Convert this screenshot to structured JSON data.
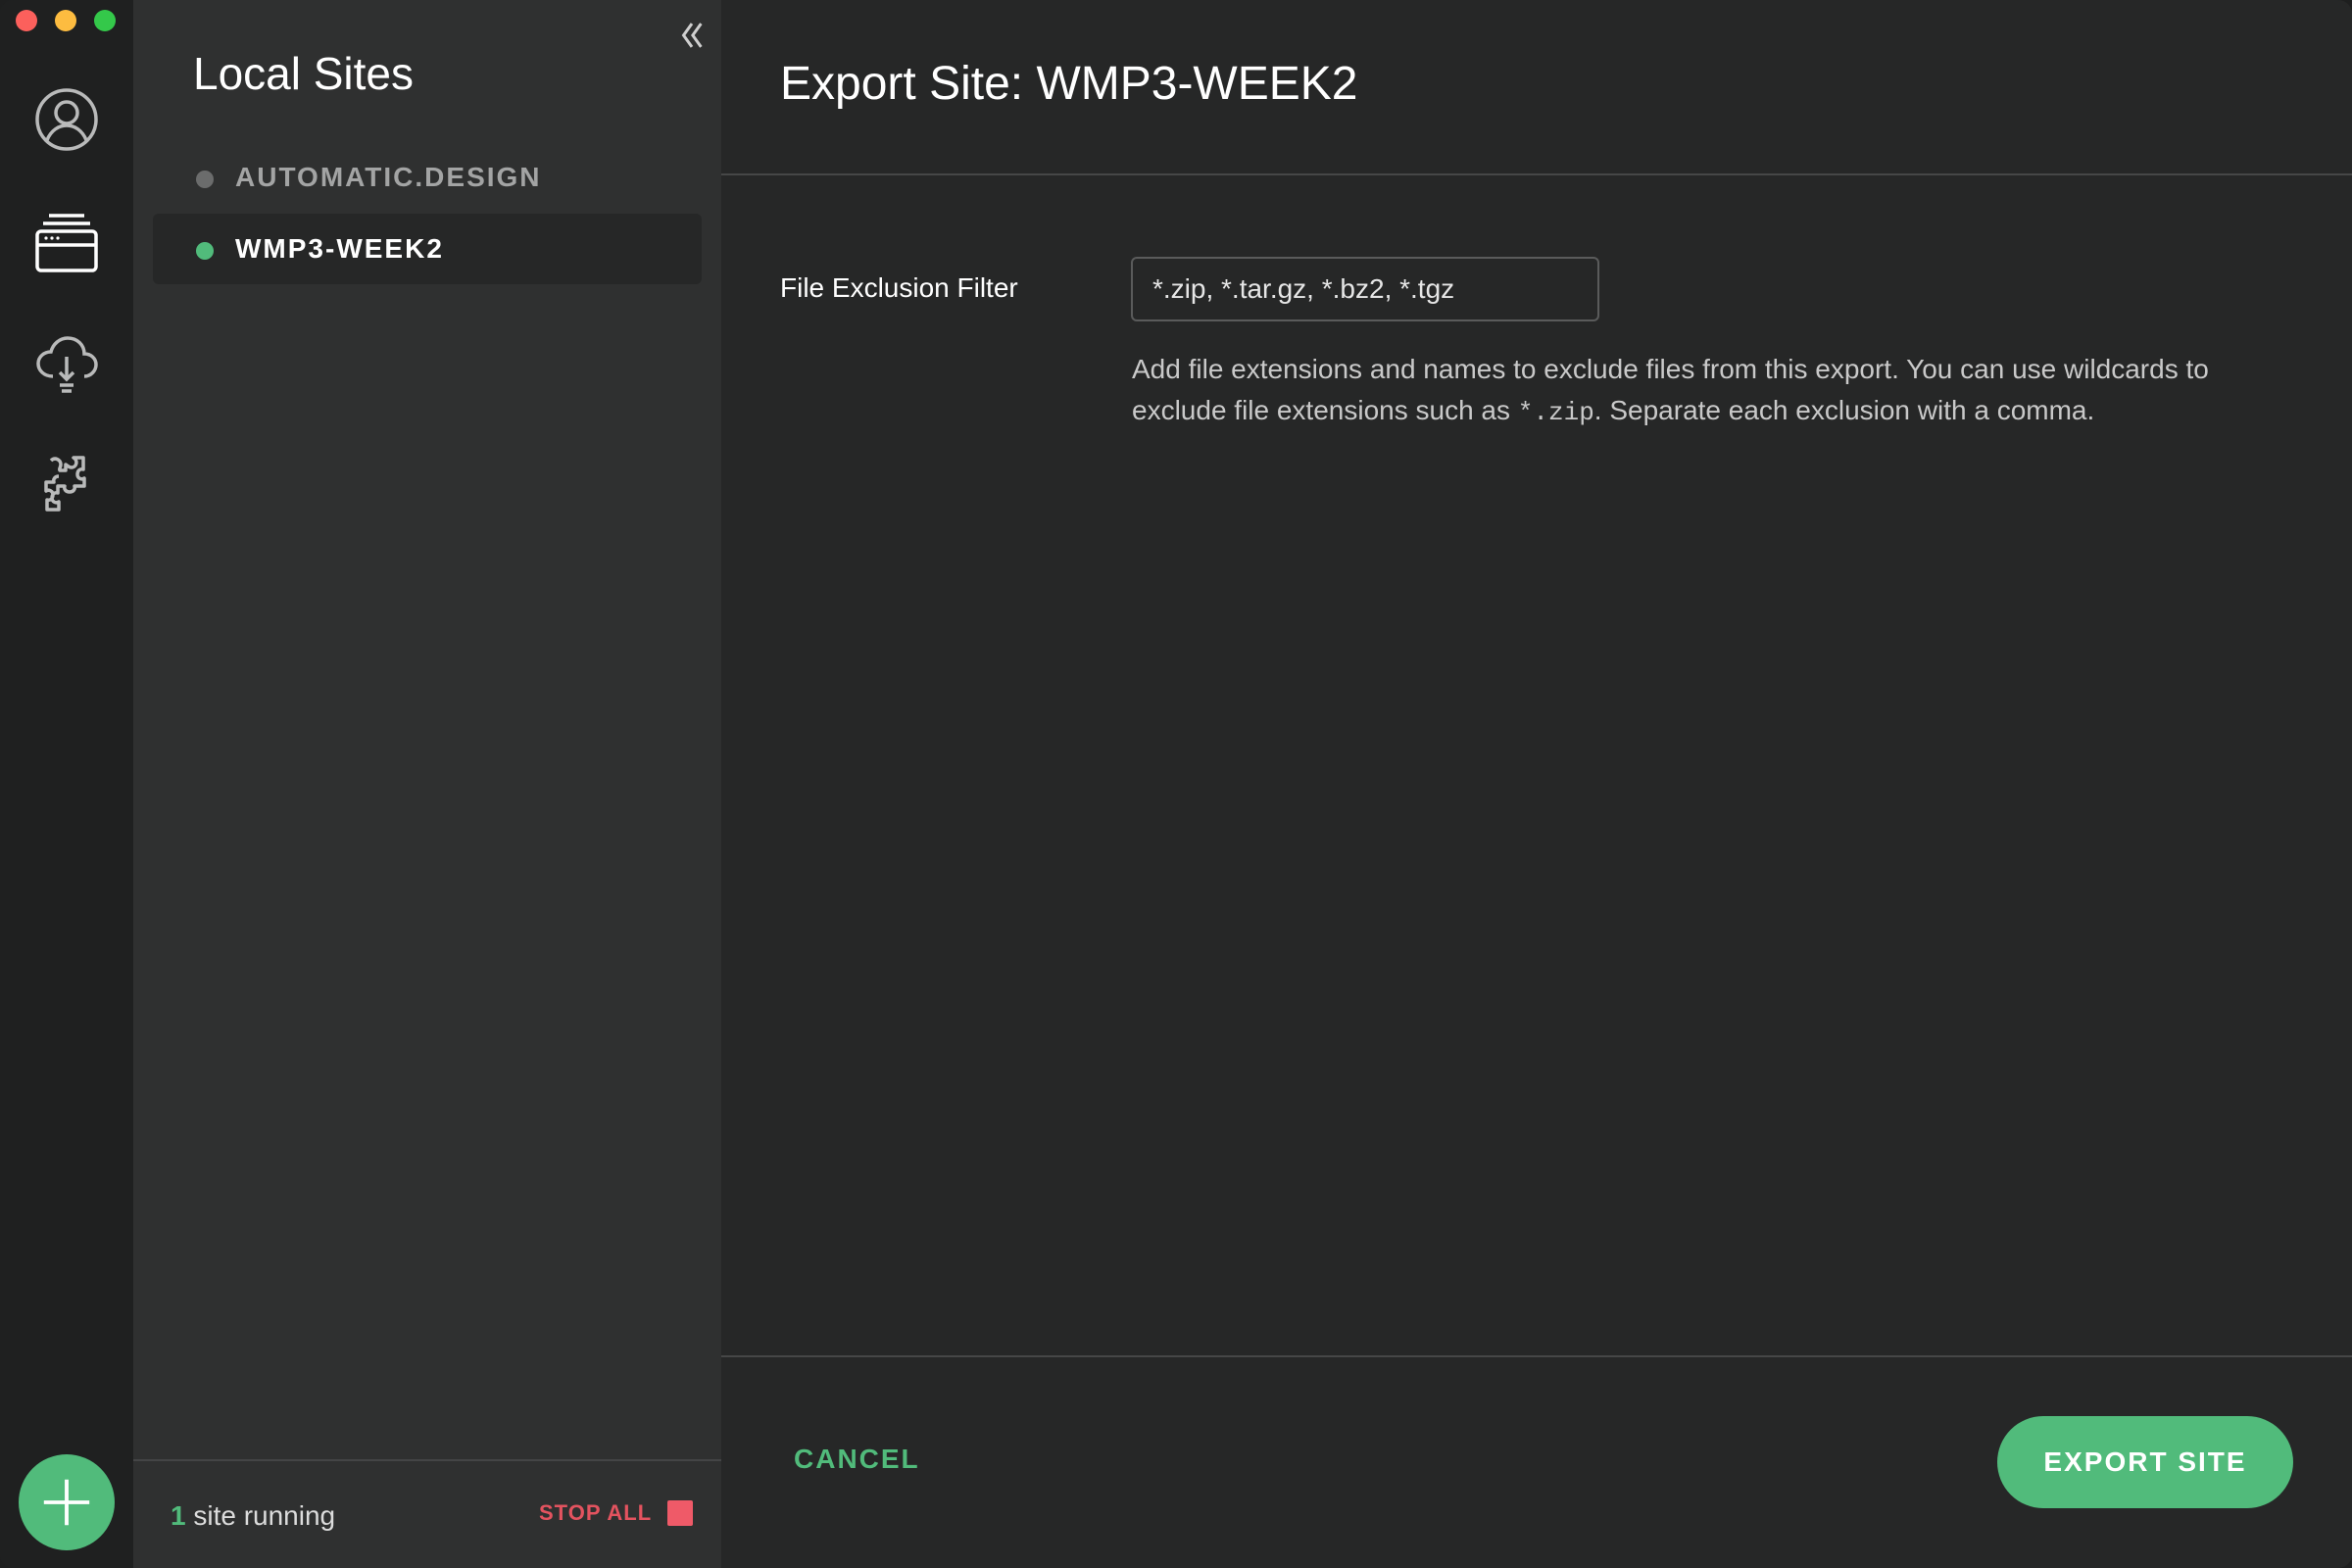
{
  "window": {
    "controls": [
      "close",
      "minimize",
      "zoom"
    ]
  },
  "rail": {
    "icons": [
      "account-icon",
      "local-sites-icon",
      "connect-cloud-icon",
      "addons-icon"
    ],
    "add_button_icon": "plus-icon"
  },
  "sidebar": {
    "title": "Local Sites",
    "collapse_icon": "double-chevron-left-icon",
    "sites": [
      {
        "name": "AUTOMATIC.DESIGN",
        "status": "stopped",
        "color": "#6b6c6c",
        "active": false
      },
      {
        "name": "WMP3-WEEK2",
        "status": "running",
        "color": "#51bb7b",
        "active": true
      }
    ],
    "footer": {
      "running_count": "1",
      "running_label": " site running",
      "stop_all_label": "STOP ALL"
    }
  },
  "main": {
    "title": "Export Site: WMP3-WEEK2",
    "filter": {
      "label": "File Exclusion Filter",
      "value": "*.zip, *.tar.gz, *.bz2, *.tgz",
      "help_before": "Add file extensions and names to exclude files from this export. You can use wildcards to exclude file extensions such as ",
      "help_code": "*.zip",
      "help_after": ". Separate each exclusion with a comma."
    },
    "cancel_label": "CANCEL",
    "export_label": "EXPORT SITE"
  },
  "colors": {
    "accent": "#51bb7b",
    "danger": "#e3535f",
    "background": "#262727",
    "sidebar": "#2f3030",
    "rail": "#1f2020"
  }
}
